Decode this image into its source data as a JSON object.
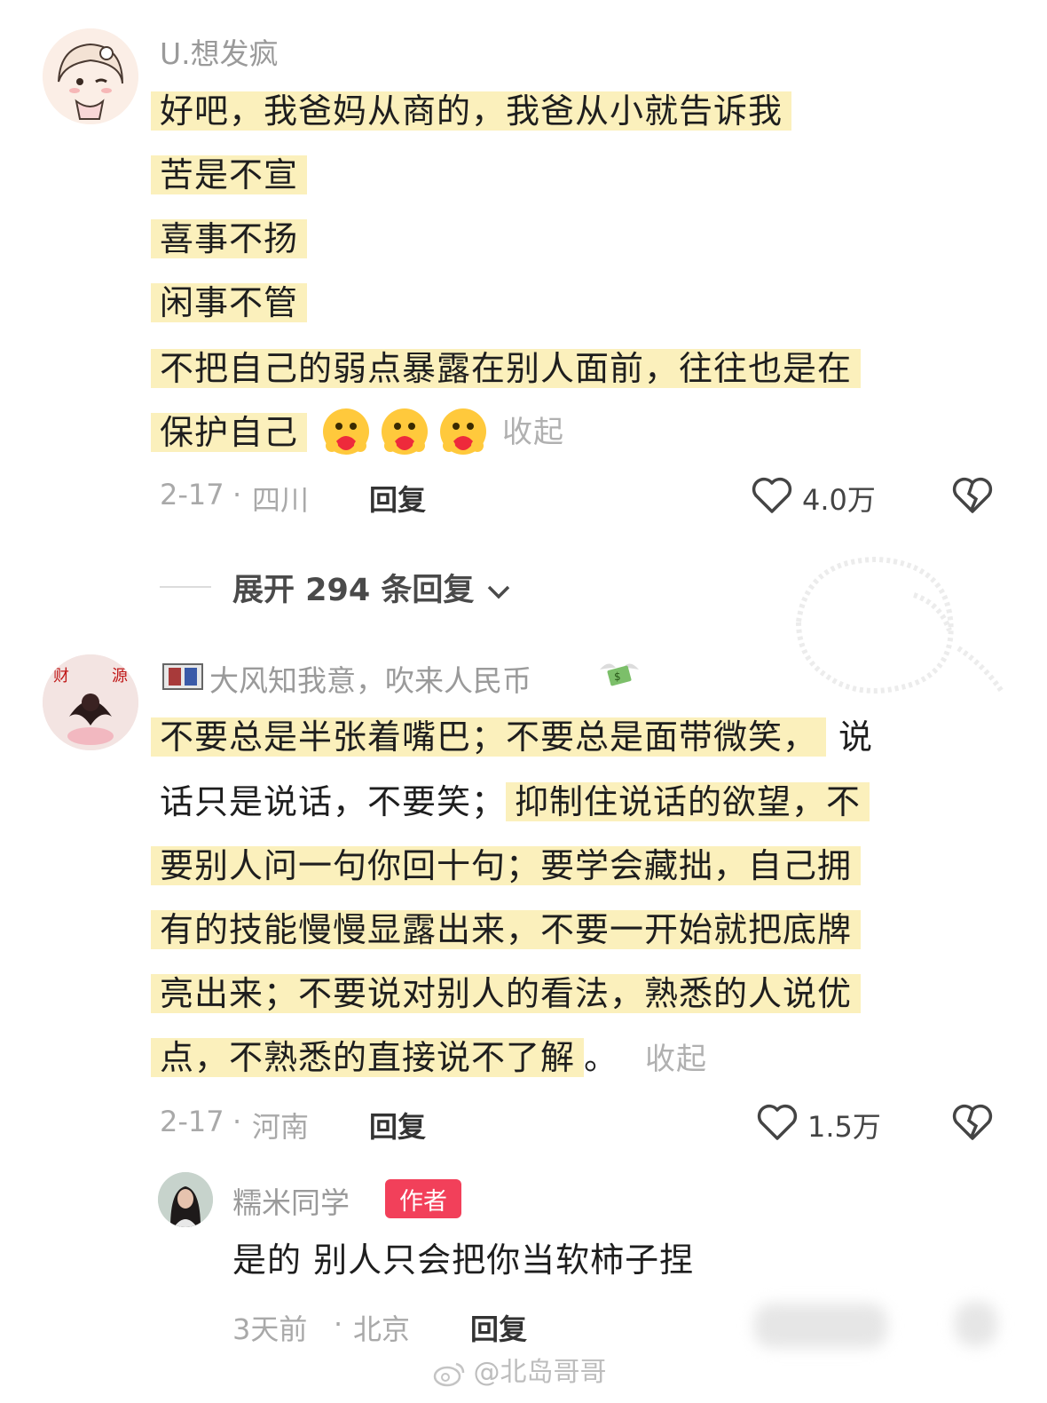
{
  "comments": [
    {
      "username": "U.想发疯",
      "lines": [
        "好吧，我爸妈从商的，我爸从小就告诉我",
        "苦是不宣",
        "喜事不扬",
        "闲事不管",
        "不把自己的弱点暴露在别人面前，往往也是在",
        "保护自己"
      ],
      "emoji": [
        "hug-heart-emoji",
        "hug-heart-emoji",
        "hug-heart-emoji"
      ],
      "collapse_label": "收起",
      "date": "2-17",
      "location": "四川",
      "reply_label": "回复",
      "like_count": "4.0万",
      "expand_replies": "展开 294 条回复"
    },
    {
      "username": "大风知我意，吹来人民币",
      "username_icons": [
        "book-icon",
        "money-wings-emoji"
      ],
      "line1_hl": "不要总是半张着嘴巴；不要总是面带微笑，",
      "line1_plain": "说",
      "line2_plain": "话只是说话，不要笑；",
      "line2_hl": "抑制住说话的欲望，不",
      "line3_hl": "要别人问一句你回十句；要学会藏拙，自己拥",
      "line4_hl": "有的技能慢慢显露出来，不要一开始就把底牌",
      "line5_hl": "亮出来；不要说对别人的看法，熟悉的人说优",
      "line6_hl": "点，不熟悉的直接说不了解",
      "line6_plain": "。",
      "collapse_label": "收起",
      "date": "2-17",
      "location": "河南",
      "reply_label": "回复",
      "like_count": "1.5万"
    }
  ],
  "sub_reply": {
    "username": "糯米同学",
    "badge": "作者",
    "text": "是的 别人只会把你当软柿子捏",
    "date": "3天前",
    "location": "北京",
    "reply_label": "回复"
  },
  "watermark": "@北岛哥哥",
  "colors": {
    "highlight": "#fbf0bc",
    "badge": "#f2405a",
    "meta_text": "#a9a9a9"
  }
}
